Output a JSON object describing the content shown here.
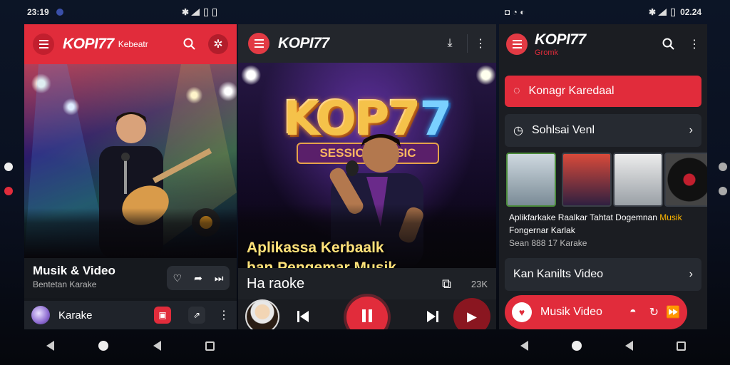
{
  "status": {
    "left": {
      "time": "23:19"
    },
    "right": {
      "time": "02.24"
    }
  },
  "panel1": {
    "brand": "KOPI77",
    "brand_sub": "Kebeatr",
    "media_title": "Musik & Video",
    "media_subtitle": "Bentetan Karake",
    "bottom_label": "Karake"
  },
  "panel2": {
    "brand": "KOPI77",
    "hero_brand_main": "KOP7",
    "hero_brand_accent": "7",
    "hero_banner": "SESSION MUSIC",
    "overlay_line1": "Aplikassa Kerbaalk",
    "overlay_line2": "ban Pengemar Musik",
    "track_title": "Ha raoke",
    "counter": "23K"
  },
  "panel3": {
    "brand": "KOPI77",
    "brand_sub": "Gromk",
    "primary_button": "Konagr Karedaal",
    "row1": "Sohlsai Venl",
    "card_line1": "Aplikfarkake Raalkar Tahtat Dogemnan",
    "card_tag": "Musik",
    "card_line2": "Fongernar Karlak",
    "card_line3": "Sean 888 17 Karake",
    "row2": "Kan Kanilts Video",
    "float_label": "Musik Video"
  },
  "colors": {
    "accent": "#e12c3b",
    "panel": "#14171c",
    "gold": "#ffe27a"
  },
  "icons": [
    "menu-icon",
    "search-icon",
    "more-vert-icon",
    "heart-icon",
    "share-icon",
    "skip-icon",
    "download-icon",
    "prev-icon",
    "pause-icon",
    "next-icon",
    "play-icon",
    "chevron-right-icon",
    "chat-icon",
    "clock-icon"
  ]
}
